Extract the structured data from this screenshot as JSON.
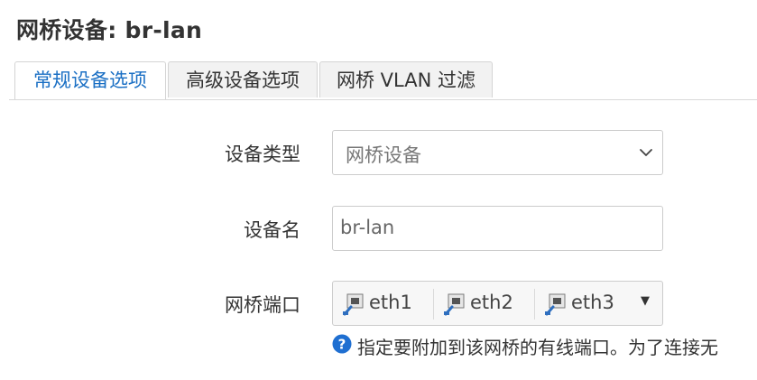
{
  "page": {
    "title": "网桥设备: br-lan"
  },
  "tabs": [
    {
      "label": "常规设备选项",
      "active": true
    },
    {
      "label": "高级设备选项",
      "active": false
    },
    {
      "label": "网桥 VLAN 过滤",
      "active": false
    }
  ],
  "form": {
    "device_type": {
      "label": "设备类型",
      "value": "网桥设备"
    },
    "device_name": {
      "label": "设备名",
      "value": "br-lan"
    },
    "bridge_ports": {
      "label": "网桥端口",
      "ports": [
        "eth1",
        "eth2",
        "eth3"
      ],
      "help": "指定要附加到该网桥的有线端口。为了连接无"
    }
  },
  "icons": {
    "port": "ethernet-port-icon",
    "help": "question-circle-icon",
    "dropdown": "chevron-down-icon"
  },
  "colors": {
    "accent": "#1a6fc4",
    "help_icon": "#1f6fd1"
  }
}
